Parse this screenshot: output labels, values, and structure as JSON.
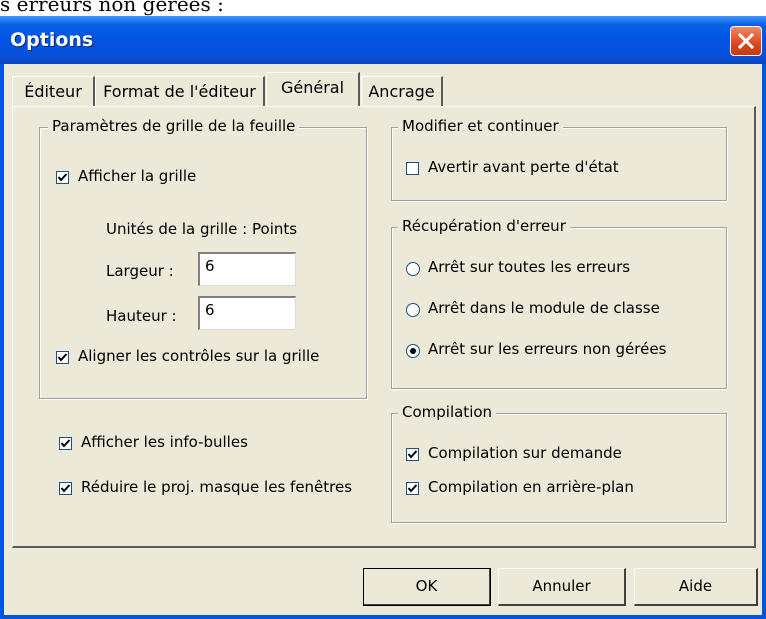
{
  "above_text": "s erreurs non gérées :",
  "window": {
    "title": "Options"
  },
  "tabs": [
    {
      "label": "Éditeur"
    },
    {
      "label": "Format de l'éditeur"
    },
    {
      "label": "Général",
      "active": true
    },
    {
      "label": "Ancrage"
    }
  ],
  "grid_group": {
    "title": "Paramètres de grille de la feuille",
    "show_grid": {
      "label": "Afficher la grille",
      "checked": true
    },
    "units_text": "Unités de la grille : Points",
    "width_label": "Largeur :",
    "width_value": "6",
    "height_label": "Hauteur :",
    "height_value": "6",
    "align": {
      "label": "Aligner les contrôles sur la grille",
      "checked": true
    }
  },
  "tooltips": {
    "label": "Afficher les info-bulles",
    "checked": true
  },
  "collapse": {
    "label": "Réduire le proj. masque les fenêtres",
    "checked": true
  },
  "edit_continue": {
    "title": "Modifier et continuer",
    "notify": {
      "label": "Avertir avant perte d'état",
      "checked": false
    }
  },
  "error_trapping": {
    "title": "Récupération d'erreur",
    "options": [
      {
        "label": "Arrêt sur toutes les erreurs",
        "selected": false
      },
      {
        "label": "Arrêt dans le module de classe",
        "selected": false
      },
      {
        "label": "Arrêt sur les erreurs non gérées",
        "selected": true
      }
    ]
  },
  "compile": {
    "title": "Compilation",
    "on_demand": {
      "label": "Compilation sur demande",
      "checked": true
    },
    "background": {
      "label": "Compilation en arrière-plan",
      "checked": true
    }
  },
  "buttons": {
    "ok": "OK",
    "cancel": "Annuler",
    "help": "Aide"
  },
  "colors": {
    "titlebar": "#0054e3",
    "face": "#ece9d8",
    "close": "#d9481f"
  }
}
